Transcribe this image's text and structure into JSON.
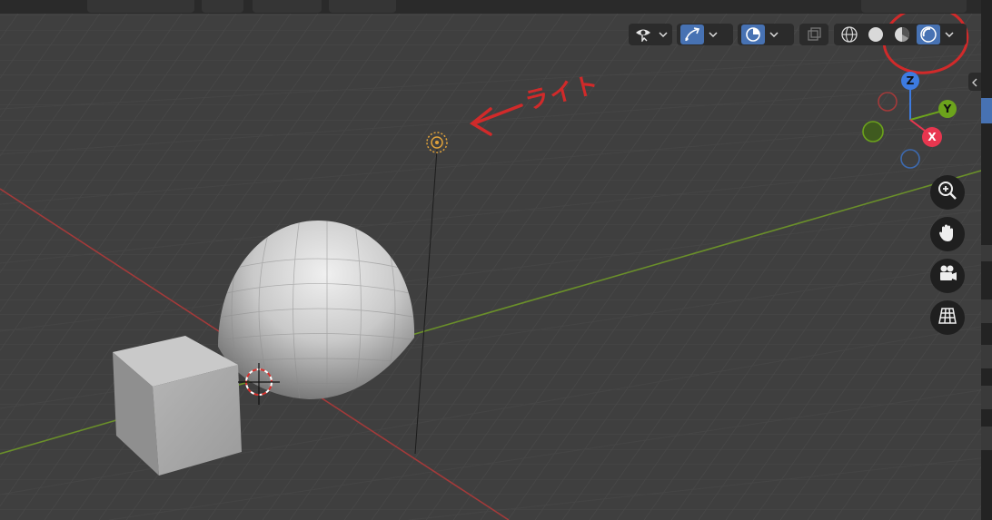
{
  "annotation": {
    "label": "ライト",
    "color": "#d12a2a"
  },
  "gizmo": {
    "z_label": "Z",
    "y_label": "Y",
    "x_label": "X",
    "colors": {
      "x": "#e8364f",
      "y": "#6ca31c",
      "z": "#3d7be0"
    }
  },
  "header": {
    "visibility_icon": "eye-pointer-icon",
    "gizmo_toggle_icon": "gizmo-arrow-icon",
    "overlay_icon": "overlay-circle-icon",
    "xray_icon": "xray-icon",
    "shading_modes": [
      "wireframe",
      "solid",
      "material-preview",
      "rendered"
    ],
    "active_shading": "rendered"
  },
  "navigation": {
    "zoom_icon": "zoom-icon",
    "pan_icon": "hand-icon",
    "camera_icon": "camera-icon",
    "ortho_icon": "grid-perspective-icon"
  },
  "colors": {
    "accent": "#4772b3",
    "x_axis_line": "#a33a3a",
    "y_axis_line": "#6a8f2a",
    "light_origin": "#e0a23b"
  }
}
